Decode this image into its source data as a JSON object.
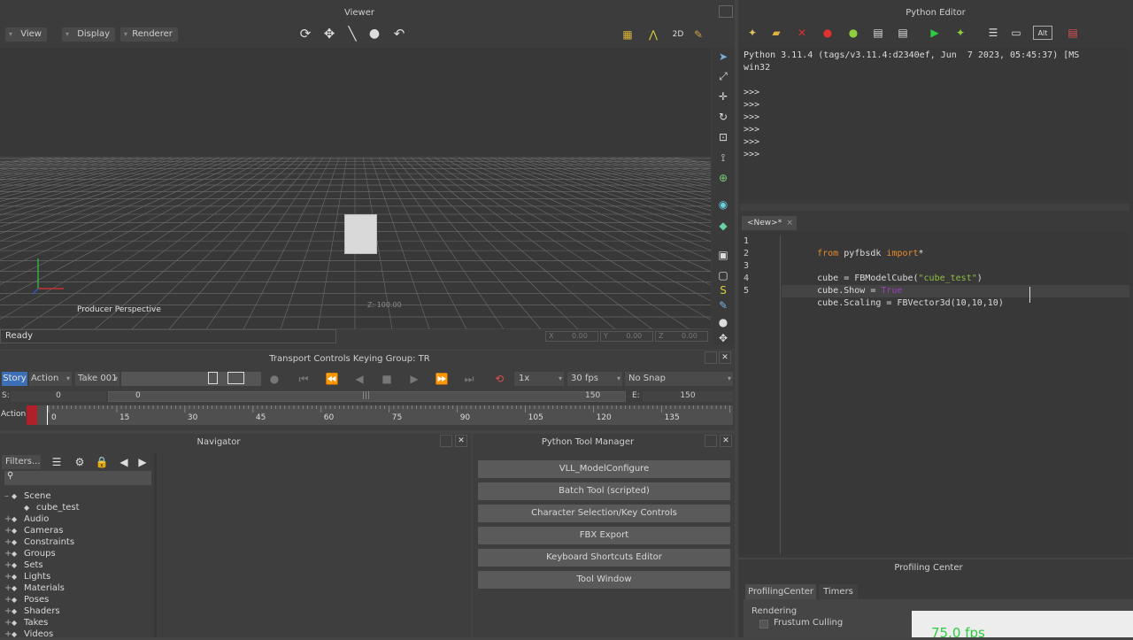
{
  "viewer": {
    "title": "Viewer",
    "menus": [
      "View",
      "Display",
      "Renderer"
    ],
    "camera_label": "Producer Perspective",
    "status": "Ready",
    "coords": {
      "x": "0.00",
      "y": "0.00",
      "z": "0.00"
    },
    "axis_readout": "Z: 100.00"
  },
  "python_editor": {
    "title": "Python Editor",
    "console_lines": [
      "Python 3.11.4 (tags/v3.11.4:d2340ef, Jun  7 2023, 05:45:37) [MS",
      "win32",
      "",
      ">>>",
      ">>>",
      ">>>",
      ">>>",
      ">>>",
      ">>>"
    ],
    "tab": "<New>*",
    "line_numbers": [
      "1",
      "2",
      "3",
      "4",
      "5"
    ],
    "code": {
      "l1_kw1": "from",
      "l1_mod": " pyfbsdk ",
      "l1_kw2": "import",
      "l1_rest": "*",
      "l3_a": "cube = FBModelCube(",
      "l3_str": "\"cube_test\"",
      "l3_b": ")",
      "l4_a": "cube.Show = ",
      "l4_kw": "True",
      "l5": "cube.Scaling = FBVector3d(10,10,10)"
    }
  },
  "transport": {
    "title": "Transport Controls   Keying Group: TR",
    "story": "Story",
    "action": "Action",
    "take": "Take 001",
    "speed": "1x",
    "fps": "30 fps",
    "snap": "No Snap",
    "start_label": "S:",
    "start_value": "0",
    "range_start": "0",
    "range_end": "150",
    "end_label": "E:",
    "end_value": "150",
    "track_label": "Action",
    "current_frame": "0",
    "ruler": [
      "0",
      "15",
      "30",
      "45",
      "60",
      "75",
      "90",
      "105",
      "120",
      "135"
    ]
  },
  "navigator": {
    "title": "Navigator",
    "filters": "Filters...",
    "tree": [
      {
        "label": "Scene",
        "indent": 1
      },
      {
        "label": "cube_test",
        "indent": 2
      },
      {
        "label": "Audio",
        "indent": 0
      },
      {
        "label": "Cameras",
        "indent": 0
      },
      {
        "label": "Constraints",
        "indent": 0
      },
      {
        "label": "Groups",
        "indent": 0
      },
      {
        "label": "Sets",
        "indent": 0
      },
      {
        "label": "Lights",
        "indent": 0
      },
      {
        "label": "Materials",
        "indent": 0
      },
      {
        "label": "Poses",
        "indent": 0
      },
      {
        "label": "Shaders",
        "indent": 0
      },
      {
        "label": "Takes",
        "indent": 0
      },
      {
        "label": "Videos",
        "indent": 0
      }
    ]
  },
  "tool_manager": {
    "title": "Python Tool Manager",
    "tools": [
      "VLL_ModelConfigure",
      "Batch Tool (scripted)",
      "Character Selection/Key Controls",
      "FBX Export",
      "Keyboard Shortcuts Editor",
      "Tool Window"
    ]
  },
  "profiling": {
    "title": "Profiling Center",
    "tabs": [
      "ProfilingCenter",
      "Timers"
    ],
    "section": "Rendering",
    "checkbox": "Frustum Culling",
    "fps": "75.0 fps"
  },
  "colors": {
    "keyword": "#e88a2c",
    "string": "#8fbf3f",
    "bool": "#9a3fbf",
    "accent": "#3d6fb6"
  }
}
